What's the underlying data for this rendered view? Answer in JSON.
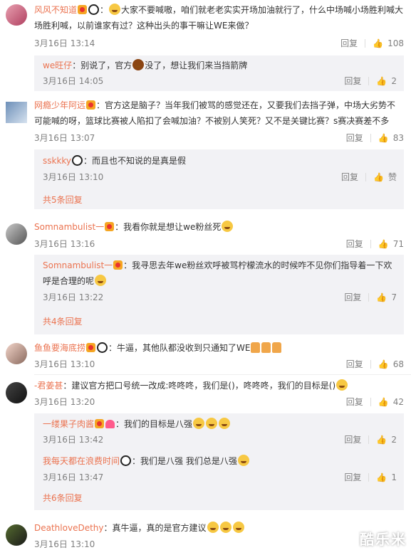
{
  "comments": [
    {
      "user": "风风不知道",
      "text": "大家不要喊嗷，咱们就老老实实开场加油就行了，什么中场喊小场胜利喊大场胜利喊，以前谁家有过？这种出头的事干嘛让WE来做？",
      "time": "3月16日 13:14",
      "reply": "回复",
      "likes": "108",
      "sub": [
        {
          "user": "we旺仔",
          "text": "别说了，官方",
          "text2": "没了，想让我们来当挡箭牌",
          "time": "3月16日 14:05",
          "reply": "回复",
          "likes": "2"
        }
      ]
    },
    {
      "user": "网瘾少年阿远",
      "text": "官方这是脑子？当年我们被骂的感觉还在，又要我们去挡子弹，中场大劣势不可能喊的呀，篮球比赛被人陷扣了会喊加油？不被别人笑死？又不是关键比赛？s赛决赛差不多",
      "time": "3月16日 13:07",
      "reply": "回复",
      "likes": "83",
      "sub": [
        {
          "user": "sskkky",
          "text": "而且也不知说的是真是假",
          "time": "3月16日 13:10",
          "reply": "回复",
          "likes": "赞"
        }
      ],
      "more": "共5条回复"
    },
    {
      "user": "Somnambulist一",
      "text": "我看你就是想让we粉丝死",
      "time": "3月16日 13:16",
      "reply": "回复",
      "likes": "71",
      "sub": [
        {
          "user": "Somnambulist一",
          "text": "我寻思去年we粉丝欢呼被骂柠檬流水的时候咋不见你们指导着一下欢呼是合理的呢",
          "time": "3月16日 13:22",
          "reply": "回复",
          "likes": "7"
        }
      ],
      "more": "共4条回复"
    },
    {
      "user": "鱼鱼要海底捞",
      "text": "牛逼，其他队都没收到只通知了WE",
      "time": "3月16日 13:10",
      "reply": "回复",
      "likes": "68"
    },
    {
      "user": "-君姜甚",
      "text": "建议官方把口号统一改成:咚咚咚，我们是()，咚咚咚，我们的目标是()",
      "time": "3月16日 13:20",
      "reply": "回复",
      "likes": "42",
      "sub": [
        {
          "user": "一缕果子肉酱",
          "text": "我们的目标是八强",
          "time": "3月16日 13:42",
          "reply": "回复",
          "likes": "2"
        },
        {
          "user": "我每天都在浪费时间",
          "text": "我们是八强 我们总是八强",
          "time": "3月16日 13:47",
          "reply": "回复",
          "likes": "1"
        }
      ],
      "more": "共6条回复"
    },
    {
      "user": "DeathloveDethy",
      "text": "真牛逼，真的是官方建议",
      "time": "3月16日 13:10",
      "reply": "回复"
    }
  ],
  "watermark": "酷乐米"
}
